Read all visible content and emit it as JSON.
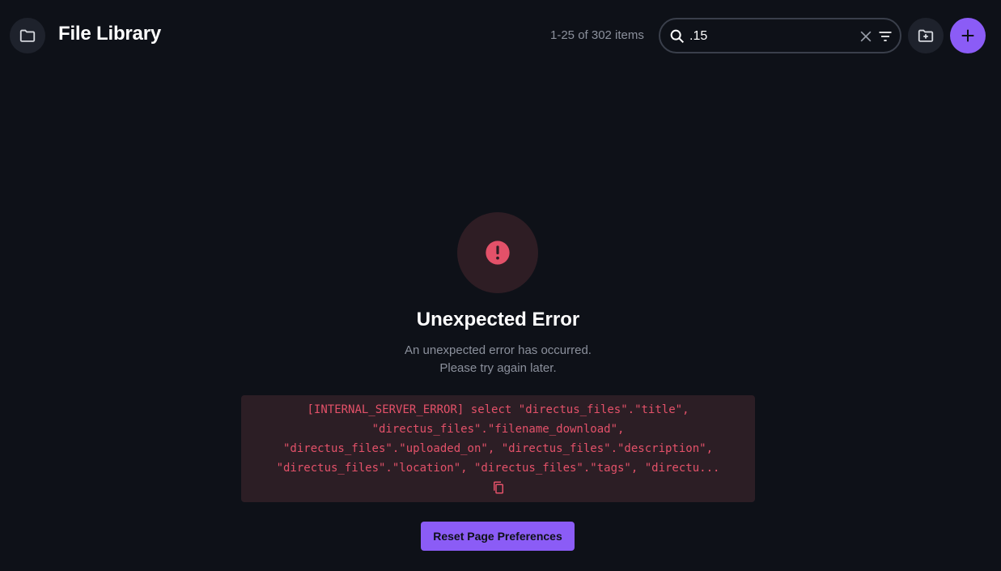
{
  "header": {
    "title": "File Library",
    "item_count": "1-25 of 302 items",
    "search": {
      "value": ".15"
    },
    "nav_icon": "folder-icon",
    "folder_add_icon": "folder-plus-icon",
    "add_icon": "plus-icon"
  },
  "error": {
    "icon": "alert-circle-icon",
    "title": "Unexpected Error",
    "message_line1": "An unexpected error has occurred.",
    "message_line2": "Please try again later.",
    "code_lines": [
      "[INTERNAL_SERVER_ERROR] select \"directus_files\".\"title\",",
      "\"directus_files\".\"filename_download\",",
      "\"directus_files\".\"uploaded_on\", \"directus_files\".\"description\",",
      "\"directus_files\".\"location\", \"directus_files\".\"tags\", \"directu..."
    ],
    "copy_icon": "copy-icon"
  },
  "actions": {
    "reset_label": "Reset Page Preferences"
  },
  "colors": {
    "background": "#0e1118",
    "accent": "#8b5cf6",
    "danger": "#e35169",
    "danger_bg": "#2c1e25",
    "muted_text": "#8b909c"
  }
}
